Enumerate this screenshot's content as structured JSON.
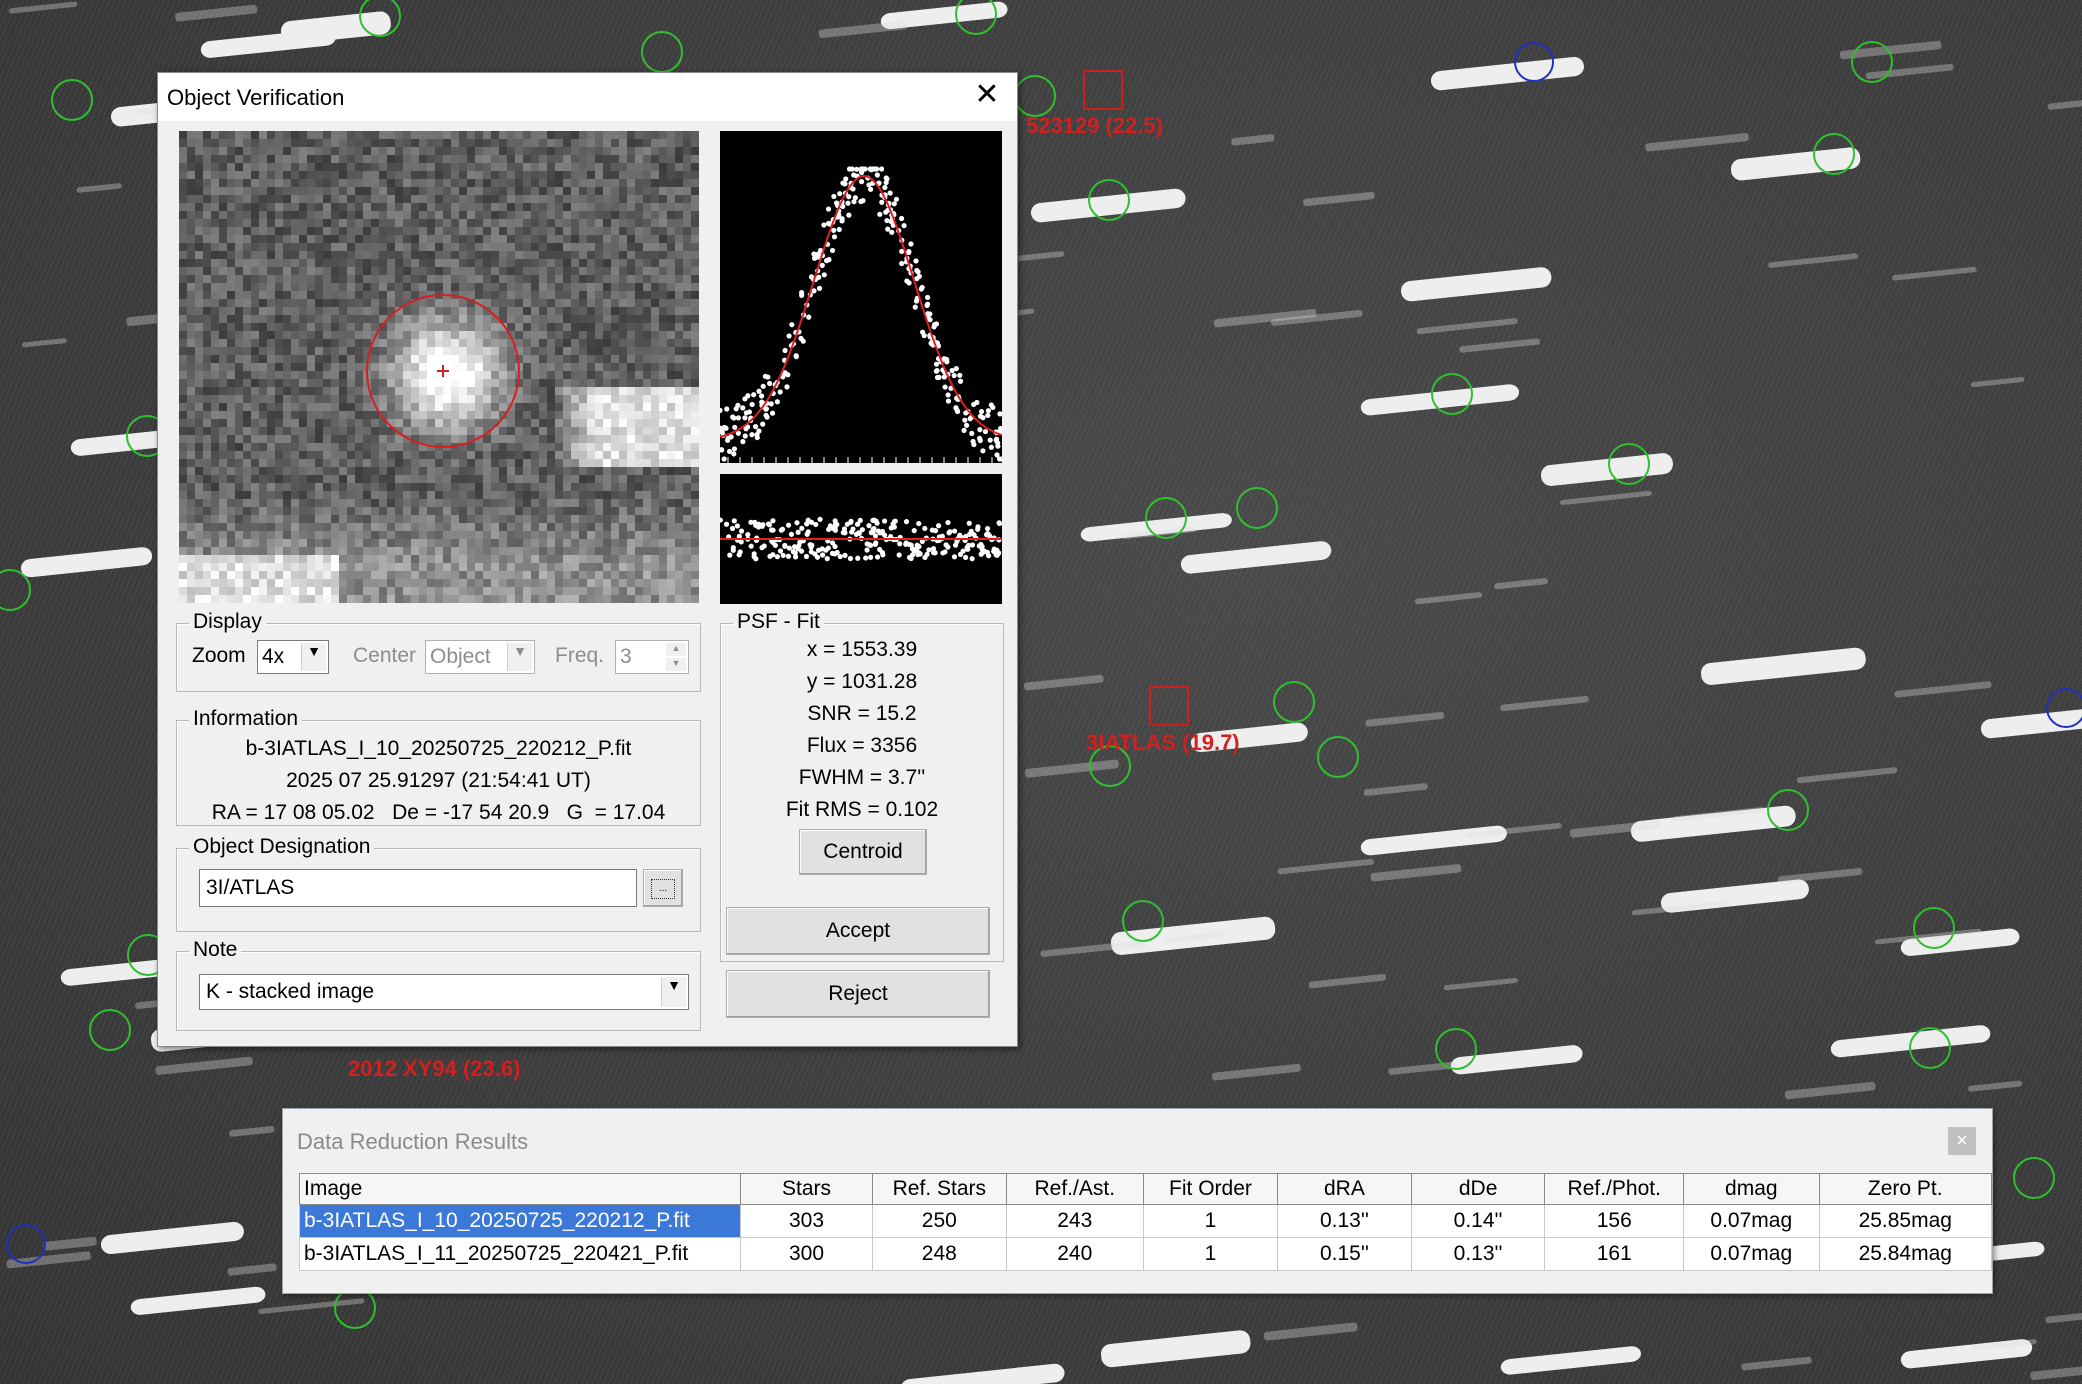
{
  "sky": {
    "labels": [
      "523129 (22.5)",
      "3IATLAS (19.7)",
      "2012 XY94 (23.6)"
    ]
  },
  "dialog": {
    "title": "Object Verification",
    "display": {
      "group_label": "Display",
      "zoom_label": "Zoom",
      "zoom_value": "4x",
      "center_label": "Center",
      "center_value": "Object",
      "freq_label": "Freq.",
      "freq_value": "3"
    },
    "information": {
      "group_label": "Information",
      "file": "b-3IATLAS_I_10_20250725_220212_P.fit",
      "date": "2025 07 25.91297 (21:54:41 UT)",
      "coords": "RA = 17 08 05.02   De = -17 54 20.9   G  = 17.04"
    },
    "designation": {
      "group_label": "Object Designation",
      "value": "3I/ATLAS",
      "browse_label": "..."
    },
    "note": {
      "group_label": "Note",
      "value": "K - stacked image"
    },
    "psf": {
      "group_label": "PSF - Fit",
      "x": "x = 1553.39",
      "y": "y = 1031.28",
      "snr": "SNR = 15.2",
      "flux": "Flux = 3356",
      "fwhm": "FWHM = 3.7''",
      "fit_rms": "Fit RMS = 0.102",
      "centroid_label": "Centroid"
    },
    "accept_label": "Accept",
    "reject_label": "Reject"
  },
  "results": {
    "title": "Data Reduction Results",
    "close_label": "×",
    "columns": [
      "Image",
      "Stars",
      "Ref. Stars",
      "Ref./Ast.",
      "Fit Order",
      "dRA",
      "dDe",
      "Ref./Phot.",
      "dmag",
      "Zero Pt."
    ],
    "rows": [
      [
        "b-3IATLAS_I_10_20250725_220212_P.fit",
        "303",
        "250",
        "243",
        "1",
        "0.13''",
        "0.14''",
        "156",
        "0.07mag",
        "25.85mag"
      ],
      [
        "b-3IATLAS_I_11_20250725_220421_P.fit",
        "300",
        "248",
        "240",
        "1",
        "0.15''",
        "0.13''",
        "161",
        "0.07mag",
        "25.84mag"
      ]
    ]
  }
}
